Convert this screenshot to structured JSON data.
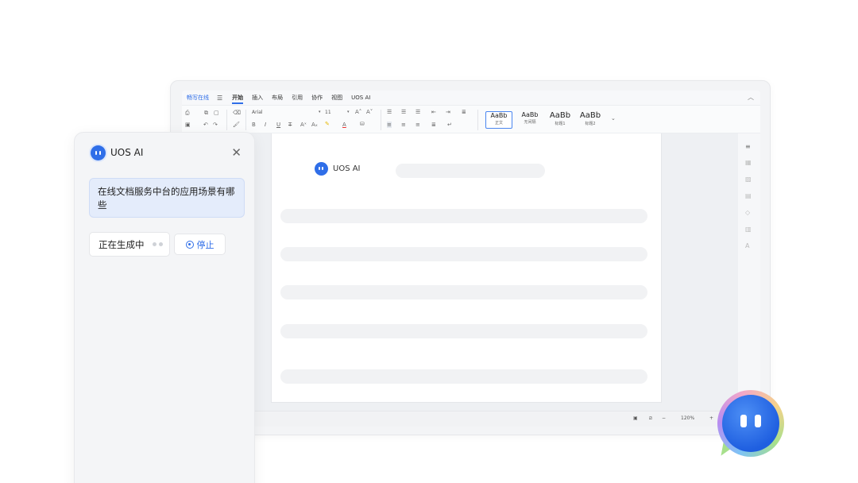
{
  "editor": {
    "brand": "畅写在线",
    "menu_tabs": [
      "开始",
      "插入",
      "布局",
      "引用",
      "协作",
      "视图",
      "UOS AI"
    ],
    "font_name": "Arial",
    "font_size": "11",
    "styles": [
      {
        "preview": "AaBb",
        "label": "正文"
      },
      {
        "preview": "AaBb",
        "label": "无间隔"
      },
      {
        "preview": "AaBb",
        "label": "标题1"
      },
      {
        "preview": "AaBb",
        "label": "标题2"
      }
    ],
    "doc_ai_name": "UOS AI",
    "zoom": "120%"
  },
  "panel": {
    "title": "UOS AI",
    "question": "在线文档服务中台的应用场景有哪些",
    "generating": "正在生成中",
    "stop_label": "停止"
  },
  "colors": {
    "accent": "#2f6ee8",
    "bubble_bg": "#e4ecfb"
  }
}
